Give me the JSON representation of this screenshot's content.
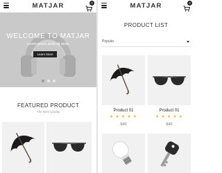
{
  "home": {
    "brand": "MATJAR",
    "cart_count": "0",
    "hero": {
      "title": "WELCOME TO MATJAR",
      "subtitle": "Lorem ipsum dolor sit amet.",
      "button": "Learn More"
    },
    "featured": {
      "title": "FEATURED PRODUCT",
      "subtitle": "The Best Quality"
    },
    "products": [
      {
        "icon": "umbrella-icon"
      },
      {
        "icon": "sunglasses-icon"
      }
    ]
  },
  "list": {
    "brand": "MATJAR",
    "cart_count": "0",
    "title": "PRODUCT LIST",
    "sort_selected": "Popular",
    "products": [
      {
        "icon": "umbrella-icon",
        "name": "Product 01",
        "stars": "★ ★ ★ ★ ★",
        "rating": 5,
        "price": "$40"
      },
      {
        "icon": "sunglasses-icon",
        "name": "Product 01",
        "stars": "★ ★ ★ ★ ★",
        "rating": 5,
        "price": "$40"
      },
      {
        "icon": "lightbulb-icon"
      },
      {
        "icon": "key-icon"
      }
    ]
  }
}
